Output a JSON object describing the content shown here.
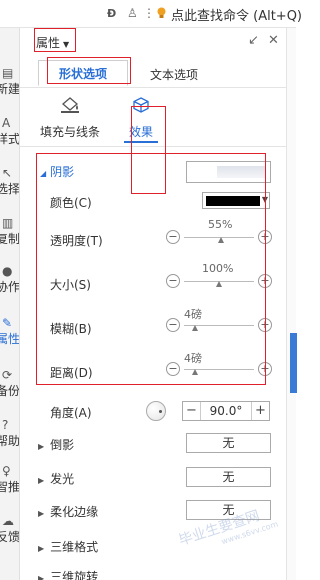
{
  "topbar": {
    "command_search": "点此查找命令 (Alt+Q)",
    "icons": [
      "d-icon",
      "person-icon",
      "more-icon",
      "bulb-icon"
    ]
  },
  "left_strip": [
    {
      "label": "新建",
      "icon": "new-icon"
    },
    {
      "label": "样式",
      "icon": "style-icon"
    },
    {
      "label": "选择",
      "icon": "select-icon"
    },
    {
      "label": "复制",
      "icon": "copy-icon"
    },
    {
      "label": "协作",
      "icon": "collab-icon"
    },
    {
      "label": "属性",
      "icon": "property-icon",
      "active": true
    },
    {
      "label": "备份",
      "icon": "backup-icon"
    },
    {
      "label": "帮助",
      "icon": "help-icon"
    },
    {
      "label": "智推",
      "icon": "recommend-icon"
    },
    {
      "label": "反馈",
      "icon": "feedback-icon"
    }
  ],
  "panel": {
    "title": "属性",
    "tabs": {
      "shape": "形状选项",
      "text": "文本选项"
    },
    "subtabs": {
      "fill_line": "填充与线条",
      "effect": "效果"
    }
  },
  "shadow": {
    "header": "阴影",
    "color_label": "颜色(C)",
    "color_value": "#000000",
    "rows": [
      {
        "label": "透明度(T)",
        "value": "55%",
        "pos": 0.55
      },
      {
        "label": "大小(S)",
        "value": "100%",
        "pos": 0.5
      },
      {
        "label": "模糊(B)",
        "value": "4磅",
        "pos": 0.0
      },
      {
        "label": "距离(D)",
        "value": "4磅",
        "pos": 0.0
      }
    ]
  },
  "angle": {
    "label": "角度(A)",
    "value": "90.0°",
    "minus": "−",
    "plus": "+"
  },
  "sections": [
    {
      "label": "倒影",
      "button": "无"
    },
    {
      "label": "发光",
      "button": "无"
    },
    {
      "label": "柔化边缘",
      "button": "无"
    },
    {
      "label": "三维格式"
    },
    {
      "label": "三维旋转"
    }
  ],
  "watermark": {
    "main": "毕业生要查网",
    "sub": "www.s6vv.com"
  },
  "colors": {
    "accent": "#2a6fd6",
    "annotation": "#e0202a"
  }
}
